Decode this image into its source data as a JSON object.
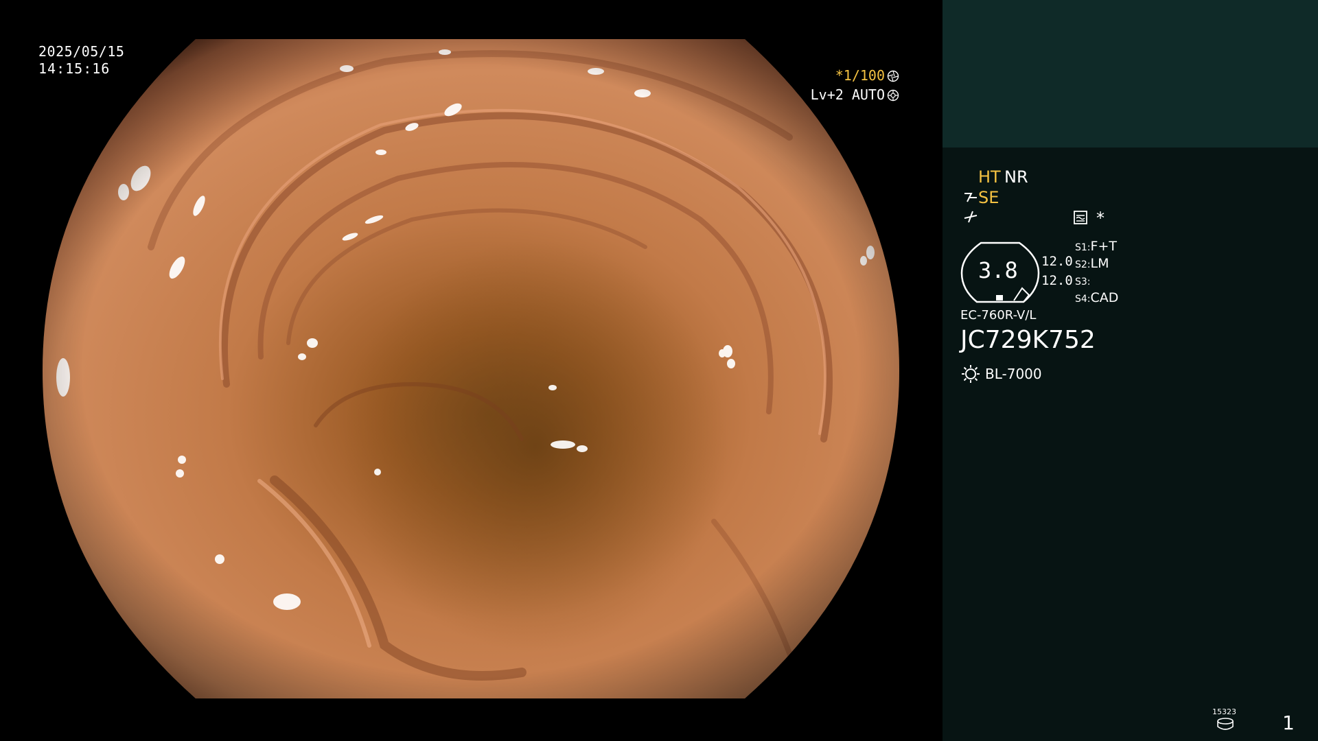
{
  "overlay": {
    "date": "2025/05/15",
    "time": "14:15:16",
    "shutter": "*1/100",
    "iris": "Lv+2 AUTO",
    "shutter_icon": "aperture-icon",
    "iris_icon": "aperture-auto-icon"
  },
  "panel": {
    "ht": "HT",
    "nr": "NR",
    "se": "SE",
    "se_icon": "structure-enhancement-icon",
    "sharpness_icon": "sharpness-icon",
    "enhancement_icon": "enhancement-mode-icon",
    "star": "*",
    "gauge": {
      "value": "3.8",
      "upper": "12.0",
      "lower": "12.0"
    },
    "switches": [
      {
        "label": "S1:",
        "value": "F+T"
      },
      {
        "label": "S2:",
        "value": "LM"
      },
      {
        "label": "S3:",
        "value": ""
      },
      {
        "label": "S4:",
        "value": "CAD"
      }
    ],
    "scope_model": "EC-760R-V/L",
    "serial": "JC729K752",
    "light_icon": "light-source-icon",
    "light_model": "BL-7000",
    "storage_count": "15323",
    "storage_icon": "storage-disk-icon",
    "page": "1"
  },
  "colors": {
    "background": "#000000",
    "panel": "#071413",
    "panel_top": "#0f2a28",
    "accent": "#f5c242"
  }
}
